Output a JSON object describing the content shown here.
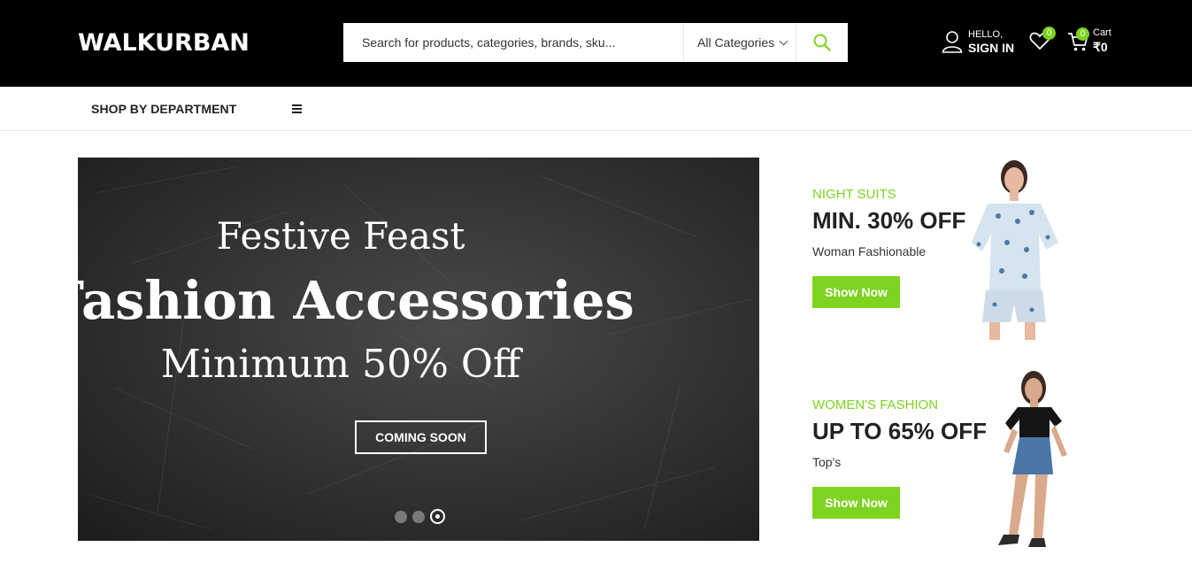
{
  "header": {
    "logo": "WALKURBAN",
    "search_placeholder": "Search for products, categories, brands, sku...",
    "category_label": "All Categories",
    "account_hello": "HELLO,",
    "account_signin": "SIGN IN",
    "wishlist_count": "0",
    "cart_count": "0",
    "cart_label": "Cart",
    "cart_total": "₹0"
  },
  "nav": {
    "department_label": "SHOP BY DEPARTMENT"
  },
  "hero": {
    "line1": "Festive Feast",
    "line2": "Fashion Accessories",
    "line3": "Minimum 50% Off",
    "button_label": "COMING SOON",
    "slides": 3,
    "active_slide": 3
  },
  "promos": [
    {
      "category": "NIGHT SUITS",
      "offer": "MIN. 30% OFF",
      "subtitle": "Woman Fashionable",
      "button_label": "Show Now"
    },
    {
      "category": "WOMEN'S FASHION",
      "offer": "UP TO 65% OFF",
      "subtitle": "Top's",
      "button_label": "Show Now"
    }
  ],
  "colors": {
    "accent": "#7ed321",
    "header_bg": "#000000",
    "hero_bg": "#3a3a3a"
  },
  "icons": [
    "search-icon",
    "user-icon",
    "heart-icon",
    "cart-icon",
    "menu-icon",
    "chevron-down-icon"
  ]
}
